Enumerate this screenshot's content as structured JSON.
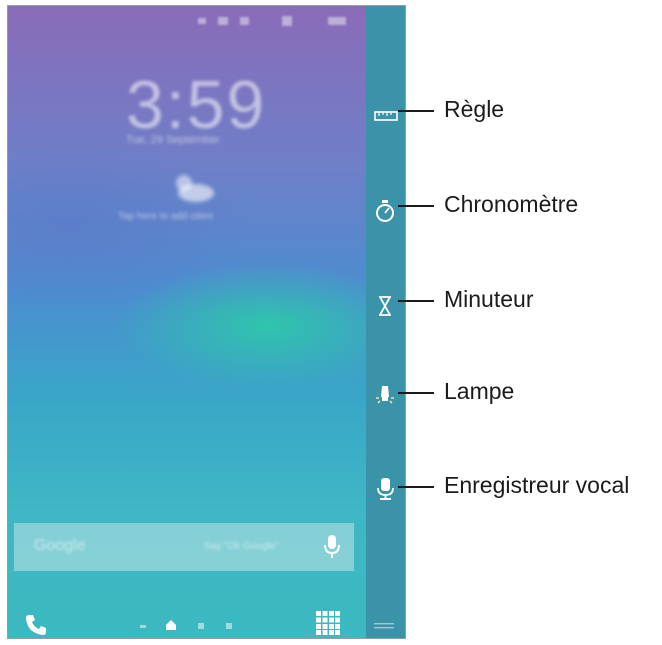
{
  "lockscreen": {
    "clock": "3:59",
    "date": "Tue, 29 September",
    "weather_hint": "Tap here to add cities"
  },
  "search": {
    "brand": "Google",
    "hint": "Say \"Ok Google\""
  },
  "edge_tools": [
    {
      "icon": "ruler-icon",
      "label": "Règle"
    },
    {
      "icon": "stopwatch-icon",
      "label": "Chronomètre"
    },
    {
      "icon": "hourglass-icon",
      "label": "Minuteur"
    },
    {
      "icon": "torch-icon",
      "label": "Lampe"
    },
    {
      "icon": "voice-recorder-icon",
      "label": "Enregistreur vocal"
    }
  ],
  "colors": {
    "edge_panel": "#3a93a8",
    "callout": "#1b1b1b"
  }
}
